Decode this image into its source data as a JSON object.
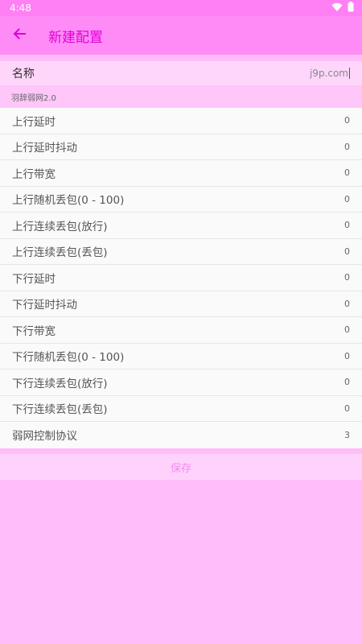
{
  "status_bar": {
    "time": "4:48",
    "wifi_icon": "wifi-icon",
    "battery_icon": "battery-icon"
  },
  "app_bar": {
    "title": "新建配置",
    "back_icon": "arrow-left-icon"
  },
  "name_field": {
    "label": "名称",
    "value": "j9p.com"
  },
  "section": {
    "title": "羽辞弱网2.0"
  },
  "rows": [
    {
      "label": "上行延时",
      "value": "0"
    },
    {
      "label": "上行延时抖动",
      "value": "0"
    },
    {
      "label": "上行带宽",
      "value": "0"
    },
    {
      "label": "上行随机丢包(0 - 100)",
      "value": "0"
    },
    {
      "label": "上行连续丢包(放行)",
      "value": "0"
    },
    {
      "label": "上行连续丢包(丢包)",
      "value": "0"
    },
    {
      "label": "下行延时",
      "value": "0"
    },
    {
      "label": "下行延时抖动",
      "value": "0"
    },
    {
      "label": "下行带宽",
      "value": "0"
    },
    {
      "label": "下行随机丢包(0 - 100)",
      "value": "0"
    },
    {
      "label": "下行连续丢包(放行)",
      "value": "0"
    },
    {
      "label": "下行连续丢包(丢包)",
      "value": "0"
    },
    {
      "label": "弱网控制协议",
      "value": "3"
    }
  ],
  "save_button": {
    "label": "保存"
  },
  "colors": {
    "accent": "#e000d8",
    "app_bar": "#ff8cf6",
    "background": "#ffbdf9"
  }
}
